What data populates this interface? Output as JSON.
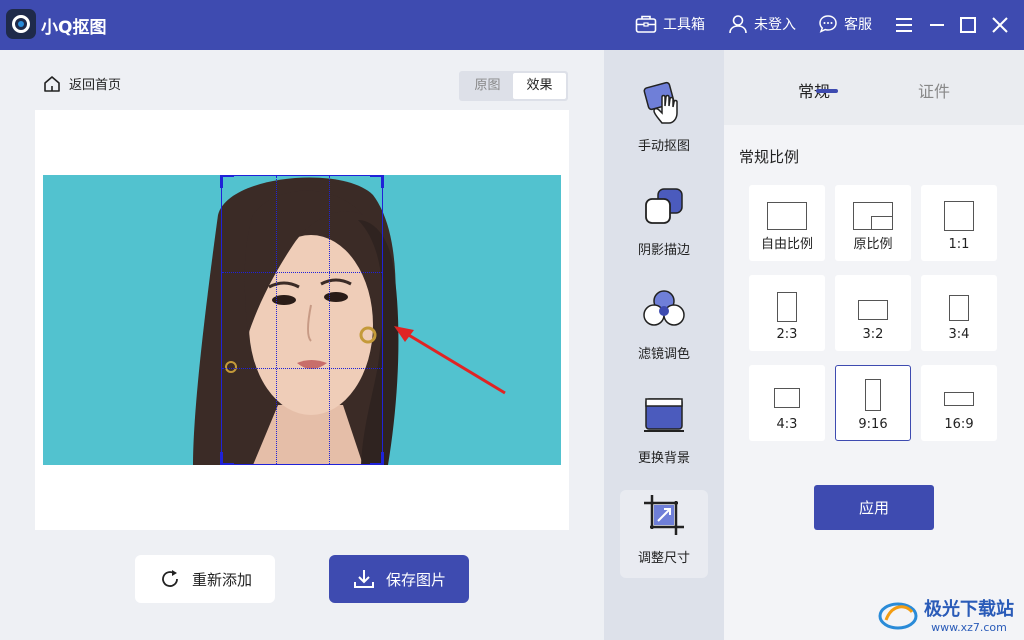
{
  "app": {
    "title": "小Q抠图"
  },
  "titlebar": {
    "toolbox": "工具箱",
    "login": "未登入",
    "service": "客服"
  },
  "left": {
    "home": "返回首页",
    "toggle": {
      "original": "原图",
      "effect": "效果"
    },
    "readd_button": "重新添加",
    "save_button": "保存图片"
  },
  "tools": [
    {
      "label": "手动抠图",
      "icon": "hand-cutout-icon"
    },
    {
      "label": "阴影描边",
      "icon": "shadow-outline-icon"
    },
    {
      "label": "滤镜调色",
      "icon": "filter-color-icon"
    },
    {
      "label": "更换背景",
      "icon": "change-background-icon"
    },
    {
      "label": "调整尺寸",
      "icon": "resize-icon",
      "active": true
    }
  ],
  "panel": {
    "tabs": {
      "normal": "常规",
      "id_photo": "证件"
    },
    "section_title": "常规比例",
    "ratios": [
      {
        "label": "自由比例"
      },
      {
        "label": "原比例"
      },
      {
        "label": "1:1"
      },
      {
        "label": "2:3"
      },
      {
        "label": "3:2"
      },
      {
        "label": "3:4"
      },
      {
        "label": "4:3"
      },
      {
        "label": "9:16",
        "selected": true
      },
      {
        "label": "16:9"
      }
    ],
    "apply_button": "应用"
  },
  "watermark": {
    "line1": "极光下载站",
    "line2": "www.xz7.com"
  },
  "colors": {
    "accent": "#3e4bb0",
    "photo_bg": "#52c2cf",
    "crop": "#1f22d8"
  }
}
